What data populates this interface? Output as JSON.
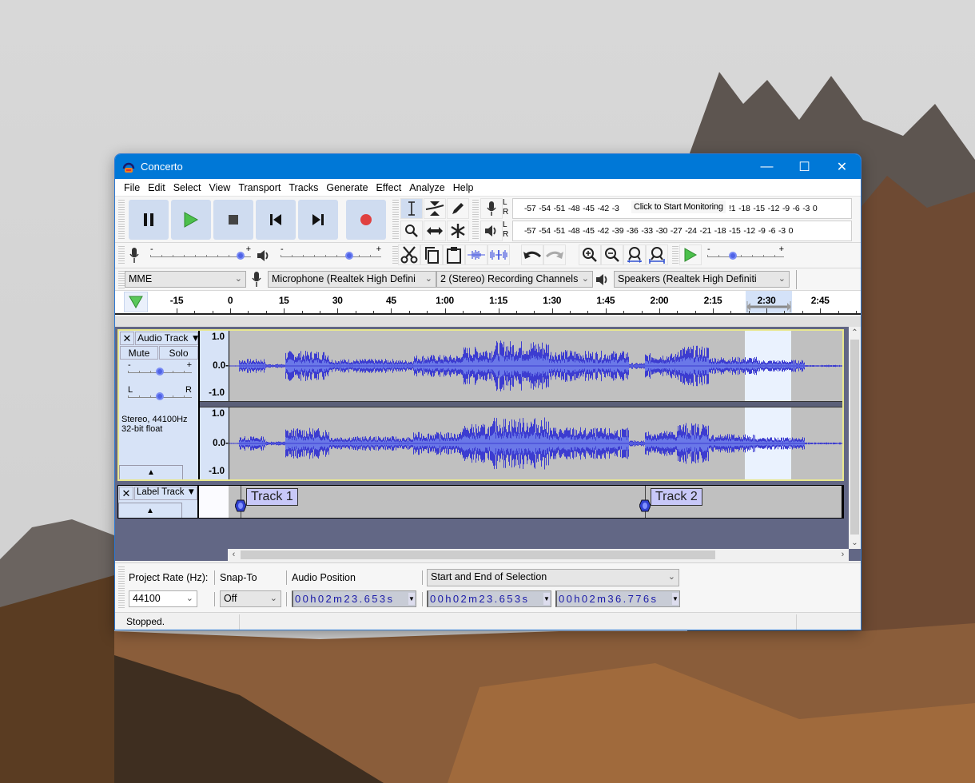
{
  "window": {
    "title": "Concerto",
    "controls": [
      "minimize",
      "maximize",
      "close"
    ]
  },
  "menu": [
    "File",
    "Edit",
    "Select",
    "View",
    "Transport",
    "Tracks",
    "Generate",
    "Effect",
    "Analyze",
    "Help"
  ],
  "transport": {
    "buttons": [
      "pause",
      "play",
      "stop",
      "skip-to-start",
      "skip-to-end",
      "record"
    ],
    "colors": {
      "play": "#4cc04c",
      "record": "#e04040",
      "button_bg": "#cfdcf0"
    }
  },
  "tools": [
    "selection-tool",
    "envelope-tool",
    "draw-tool",
    "zoom-tool",
    "time-shift-tool",
    "multi-tool"
  ],
  "meters": {
    "record": {
      "channels": [
        "L",
        "R"
      ],
      "scale": "-57 -54 -51 -48 -45 -42 -3",
      "scale_end": "!1 -18 -15 -12  -9  -6  -3  0",
      "prompt": "Click to Start Monitoring"
    },
    "playback": {
      "channels": [
        "L",
        "R"
      ],
      "scale": "-57 -54 -51 -48 -45 -42 -39 -36 -33 -30 -27 -24 -21 -18 -15 -12  -9  -6  -3  0"
    }
  },
  "mixer": {
    "record_volume": {
      "minus": "-",
      "plus": "+",
      "level": 0.9
    },
    "playback_volume": {
      "minus": "-",
      "plus": "+",
      "level": 0.68
    }
  },
  "edit_toolbar": [
    "cut",
    "copy",
    "paste",
    "trim-audio",
    "silence-audio",
    "undo",
    "redo",
    "zoom-in",
    "zoom-out",
    "fit-selection",
    "fit-project"
  ],
  "play_at_speed": {
    "minus": "-",
    "plus": "+",
    "level": 0.33
  },
  "devices": {
    "host": "MME",
    "recording_device": "Microphone (Realtek High Defini",
    "channels": "2 (Stereo) Recording Channels",
    "playback_device": "Speakers (Realtek High Definiti"
  },
  "timeline": {
    "labels": [
      "-15",
      "0",
      "15",
      "30",
      "45",
      "1:00",
      "1:15",
      "1:30",
      "1:45",
      "2:00",
      "2:15",
      "2:30",
      "2:45"
    ]
  },
  "audio_track": {
    "name": "Audio Track",
    "mute": "Mute",
    "solo": "Solo",
    "gain_minus": "-",
    "gain_plus": "+",
    "gain_level": 0.5,
    "pan_left": "L",
    "pan_right": "R",
    "pan_level": 0.5,
    "info_line1": "Stereo, 44100Hz",
    "info_line2": "32-bit float",
    "scale_top": "1.0",
    "scale_mid": "0.0-",
    "scale_bottom": "-1.0"
  },
  "label_track": {
    "name": "Label Track",
    "labels": [
      {
        "text": "Track 1",
        "time": "0:00"
      },
      {
        "text": "Track 2",
        "time": "1:55"
      }
    ]
  },
  "selection_bar": {
    "project_rate_label": "Project Rate (Hz):",
    "project_rate": "44100",
    "snap_label": "Snap-To",
    "snap_value": "Off",
    "audio_position_label": "Audio Position",
    "audio_position": "00h02m23.653s",
    "selection_mode": "Start and End of Selection",
    "selection_start": "00h02m23.653s",
    "selection_end": "00h02m36.776s"
  },
  "status": {
    "text": "Stopped."
  }
}
